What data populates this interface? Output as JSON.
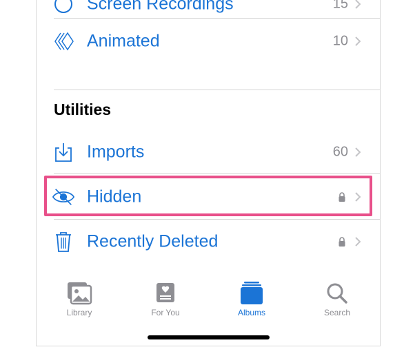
{
  "albums": {
    "partial_top": {
      "label": "Screen Recordings",
      "count": "15"
    },
    "animated": {
      "label": "Animated",
      "count": "10"
    }
  },
  "utilities": {
    "title": "Utilities",
    "imports": {
      "label": "Imports",
      "count": "60"
    },
    "hidden": {
      "label": "Hidden",
      "locked": true
    },
    "recently_deleted": {
      "label": "Recently Deleted",
      "locked": true
    }
  },
  "tabbar": {
    "tabs": [
      {
        "label": "Library",
        "icon": "photo-library-icon",
        "active": false
      },
      {
        "label": "For You",
        "icon": "for-you-icon",
        "active": false
      },
      {
        "label": "Albums",
        "icon": "albums-icon",
        "active": true
      },
      {
        "label": "Search",
        "icon": "search-icon",
        "active": false
      }
    ]
  },
  "colors": {
    "accent": "#1b74d6",
    "highlight": "#e8508a",
    "secondary": "#8e8e93"
  }
}
